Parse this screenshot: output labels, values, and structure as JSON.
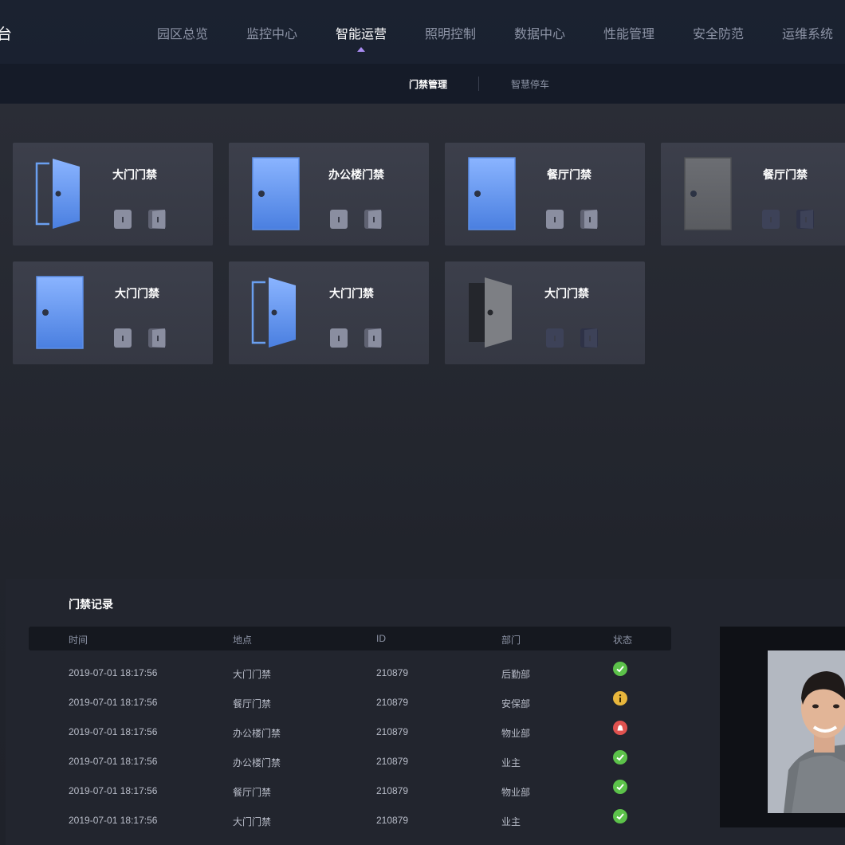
{
  "header": {
    "brand_partial": "台",
    "nav": [
      {
        "label": "园区总览",
        "active": false
      },
      {
        "label": "监控中心",
        "active": false
      },
      {
        "label": "智能运营",
        "active": true
      },
      {
        "label": "照明控制",
        "active": false
      },
      {
        "label": "数据中心",
        "active": false
      },
      {
        "label": "性能管理",
        "active": false
      },
      {
        "label": "安全防范",
        "active": false
      },
      {
        "label": "运维系统",
        "active": false
      }
    ],
    "accent": "#a98cf2"
  },
  "subnav": [
    {
      "label": "门禁管理",
      "active": true
    },
    {
      "label": "智慧停车",
      "active": false
    }
  ],
  "doors": [
    {
      "name": "大门门禁",
      "state": "open",
      "online": true
    },
    {
      "name": "办公楼门禁",
      "state": "closed",
      "online": true
    },
    {
      "name": "餐厅门禁",
      "state": "closed",
      "online": true
    },
    {
      "name": "餐厅门禁",
      "state": "closed",
      "online": false
    },
    {
      "name": "大门门禁",
      "state": "closed",
      "online": true
    },
    {
      "name": "大门门禁",
      "state": "open",
      "online": true
    },
    {
      "name": "大门门禁",
      "state": "open",
      "online": false
    }
  ],
  "records": {
    "title": "门禁记录",
    "columns": [
      "时间",
      "地点",
      "ID",
      "部门",
      "状态"
    ],
    "rows": [
      {
        "time": "2019-07-01 18:17:56",
        "location": "大门门禁",
        "id": "210879",
        "dept": "后勤部",
        "status": "ok"
      },
      {
        "time": "2019-07-01 18:17:56",
        "location": "餐厅门禁",
        "id": "210879",
        "dept": "安保部",
        "status": "warning"
      },
      {
        "time": "2019-07-01 18:17:56",
        "location": "办公楼门禁",
        "id": "210879",
        "dept": "物业部",
        "status": "alarm"
      },
      {
        "time": "2019-07-01 18:17:56",
        "location": "办公楼门禁",
        "id": "210879",
        "dept": "业主",
        "status": "ok"
      },
      {
        "time": "2019-07-01 18:17:56",
        "location": "餐厅门禁",
        "id": "210879",
        "dept": "物业部",
        "status": "ok"
      },
      {
        "time": "2019-07-01 18:17:56",
        "location": "大门门禁",
        "id": "210879",
        "dept": "业主",
        "status": "ok"
      }
    ],
    "status_colors": {
      "ok": "#5cc24a",
      "warning": "#e8b63c",
      "alarm": "#e0524f"
    }
  }
}
